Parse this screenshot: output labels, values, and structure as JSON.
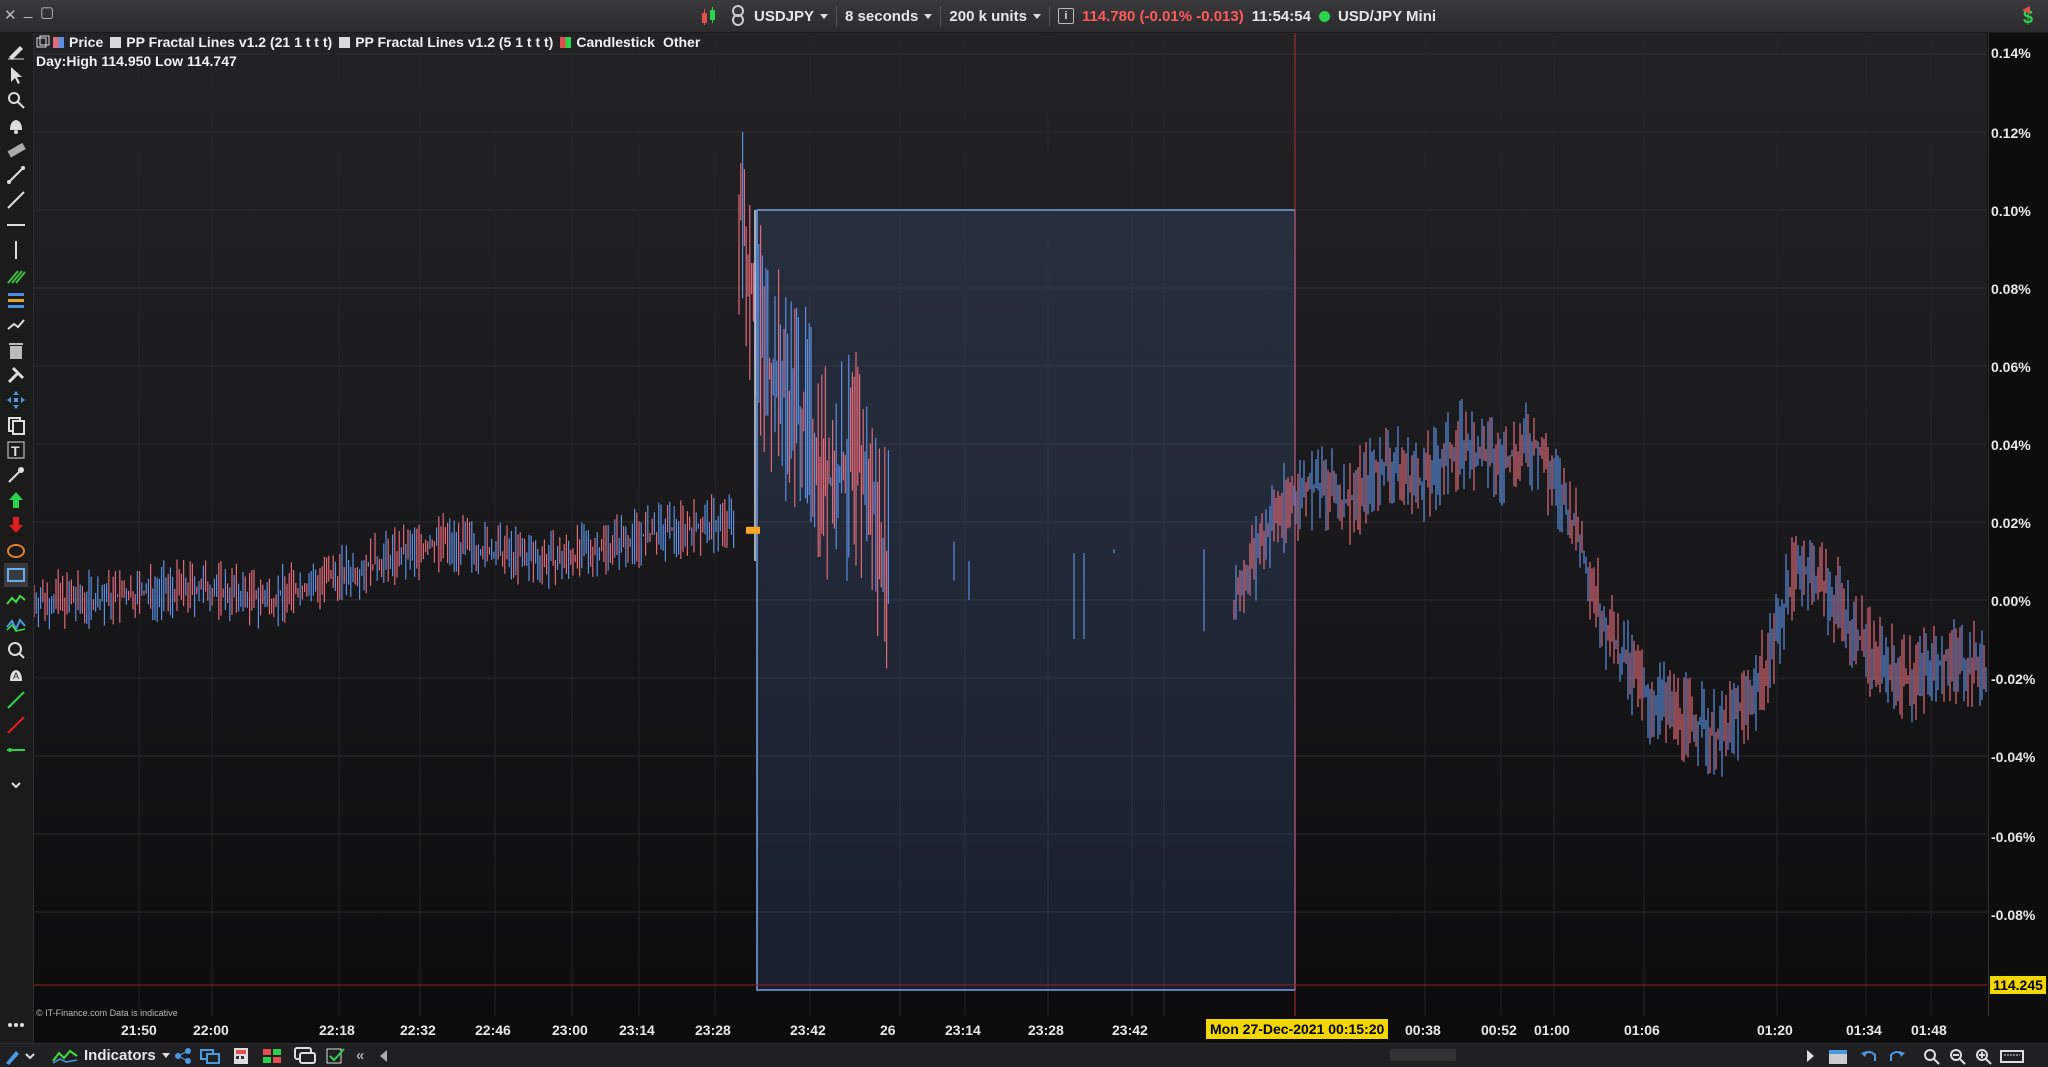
{
  "window": {
    "symbol": "USDJPY",
    "interval": "8 seconds",
    "units": "200 k units",
    "price_quote": "114.780 (-0.01% -0.013)",
    "time": "11:54:54",
    "instrument_name": "USD/JPY Mini",
    "accent_red": "#ff5a5a",
    "status_green": "#2bd24b"
  },
  "legend": {
    "price": "Price",
    "fractal1": "PP Fractal Lines v1.2 (21 1 t t t)",
    "fractal2": "PP Fractal Lines v1.2 (5 1 t t t)",
    "candlestick": "Candlestick",
    "other": "Other"
  },
  "day_high_low": "Day:High 114.950 Low 114.747",
  "copyright": "© IT-Finance.com  Data is indicative",
  "y_axis": {
    "labels": [
      "0.14%",
      "0.12%",
      "0.10%",
      "0.08%",
      "0.06%",
      "0.04%",
      "0.02%",
      "0.00%",
      "-0.02%",
      "-0.04%",
      "-0.06%",
      "-0.08%"
    ],
    "current_price": "114.245"
  },
  "x_axis": {
    "labels": [
      "21:50",
      "22:00",
      "22:18",
      "22:32",
      "22:46",
      "23:00",
      "23:14",
      "23:28",
      "23:42",
      "26",
      "23:14",
      "23:28",
      "23:42",
      "00:38",
      "00:52",
      "01:00",
      "01:06",
      "01:20",
      "01:34",
      "01:48"
    ],
    "highlight": "Mon 27-Dec-2021 00:15:20"
  },
  "chart_data": {
    "type": "candlestick",
    "symbol": "USDJPY",
    "interval": "8 seconds",
    "ylim": [
      -0.1,
      0.15
    ],
    "y_unit": "%",
    "up_color": "#5b8fe0",
    "down_color": "#e06a78",
    "segments": [
      {
        "range": "21:50-23:34",
        "trend": [
          0.0,
          0.0,
          0.002,
          0.003,
          0.0,
          0.005,
          0.01,
          0.015,
          0.012,
          0.01,
          0.015,
          0.018,
          0.02
        ]
      },
      {
        "range": "23:34-23:42",
        "trend": [
          0.1,
          0.06,
          0.05,
          0.03,
          0.035,
          0.01
        ]
      },
      {
        "range": "00:15-01:48",
        "trend": [
          0.0,
          0.02,
          0.03,
          0.025,
          0.035,
          0.03,
          0.04,
          0.035,
          0.04,
          0.02,
          -0.01,
          -0.025,
          -0.03,
          -0.035,
          -0.02,
          0.01,
          0.0,
          -0.015,
          -0.02,
          -0.015,
          -0.018
        ]
      }
    ],
    "selection": {
      "y_range": [
        -0.1,
        0.1
      ]
    }
  },
  "bottombar": {
    "indicators_label": "Indicators"
  }
}
